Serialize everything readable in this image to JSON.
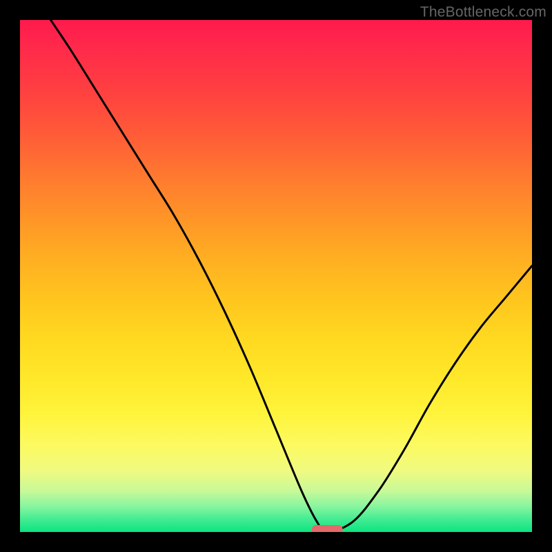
{
  "watermark": "TheBottleneck.com",
  "chart_data": {
    "type": "line",
    "title": "",
    "xlabel": "",
    "ylabel": "",
    "xlim": [
      0,
      100
    ],
    "ylim": [
      0,
      100
    ],
    "grid": false,
    "legend": false,
    "series": [
      {
        "name": "bottleneck-curve",
        "x": [
          6,
          10,
          15,
          20,
          25,
          30,
          35,
          40,
          45,
          50,
          55,
          58,
          60,
          65,
          70,
          75,
          80,
          85,
          90,
          95,
          100
        ],
        "values": [
          100,
          94,
          86,
          78,
          70,
          62,
          53,
          43,
          32,
          20,
          8,
          2,
          0,
          2,
          8,
          16,
          25,
          33,
          40,
          46,
          52
        ]
      }
    ],
    "marker": {
      "name": "optimal-range",
      "x_start": 57,
      "x_end": 63,
      "y": 0,
      "color": "#e36a6a"
    },
    "gradient_stops": [
      {
        "pos": 0.0,
        "color": "#ff1a4d"
      },
      {
        "pos": 0.5,
        "color": "#ffb820"
      },
      {
        "pos": 0.8,
        "color": "#fff43c"
      },
      {
        "pos": 1.0,
        "color": "#0be47f"
      }
    ]
  }
}
